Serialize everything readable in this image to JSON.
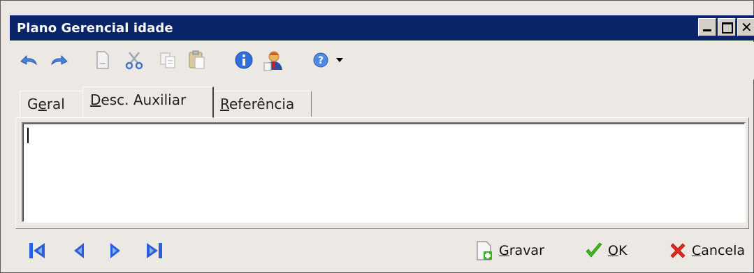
{
  "window": {
    "title": "Plano Gerencial idade",
    "controls": {
      "minimize": "minimize-icon",
      "maximize": "maximize-icon",
      "close": "close-icon"
    }
  },
  "toolbar": {
    "icons": [
      "undo-icon",
      "redo-icon",
      "new-document-icon",
      "cut-icon",
      "copy-icon",
      "paste-icon",
      "info-icon",
      "user-icon",
      "help-icon",
      "dropdown-arrow-icon"
    ]
  },
  "tabs": {
    "geral": {
      "pre": "G",
      "key": "e",
      "post": "ral"
    },
    "desc_auxiliar": {
      "pre": "",
      "key": "D",
      "post": "esc. Auxiliar",
      "active": true
    },
    "referencia": {
      "pre": "",
      "key": "R",
      "post": "eferência"
    }
  },
  "memo": {
    "value": ""
  },
  "navigation": {
    "icons": [
      "first-record-icon",
      "previous-record-icon",
      "next-record-icon",
      "last-record-icon"
    ]
  },
  "actions": {
    "gravar": {
      "key": "G",
      "rest": "ravar"
    },
    "ok": {
      "key": "O",
      "rest": "K"
    },
    "cancela": {
      "key": "C",
      "rest": "ancela"
    }
  },
  "colors": {
    "titlebar": "#0a246a",
    "nav_blue": "#2b5fd9",
    "ok_green": "#3cb81e",
    "cancel_red": "#e02a1f"
  }
}
